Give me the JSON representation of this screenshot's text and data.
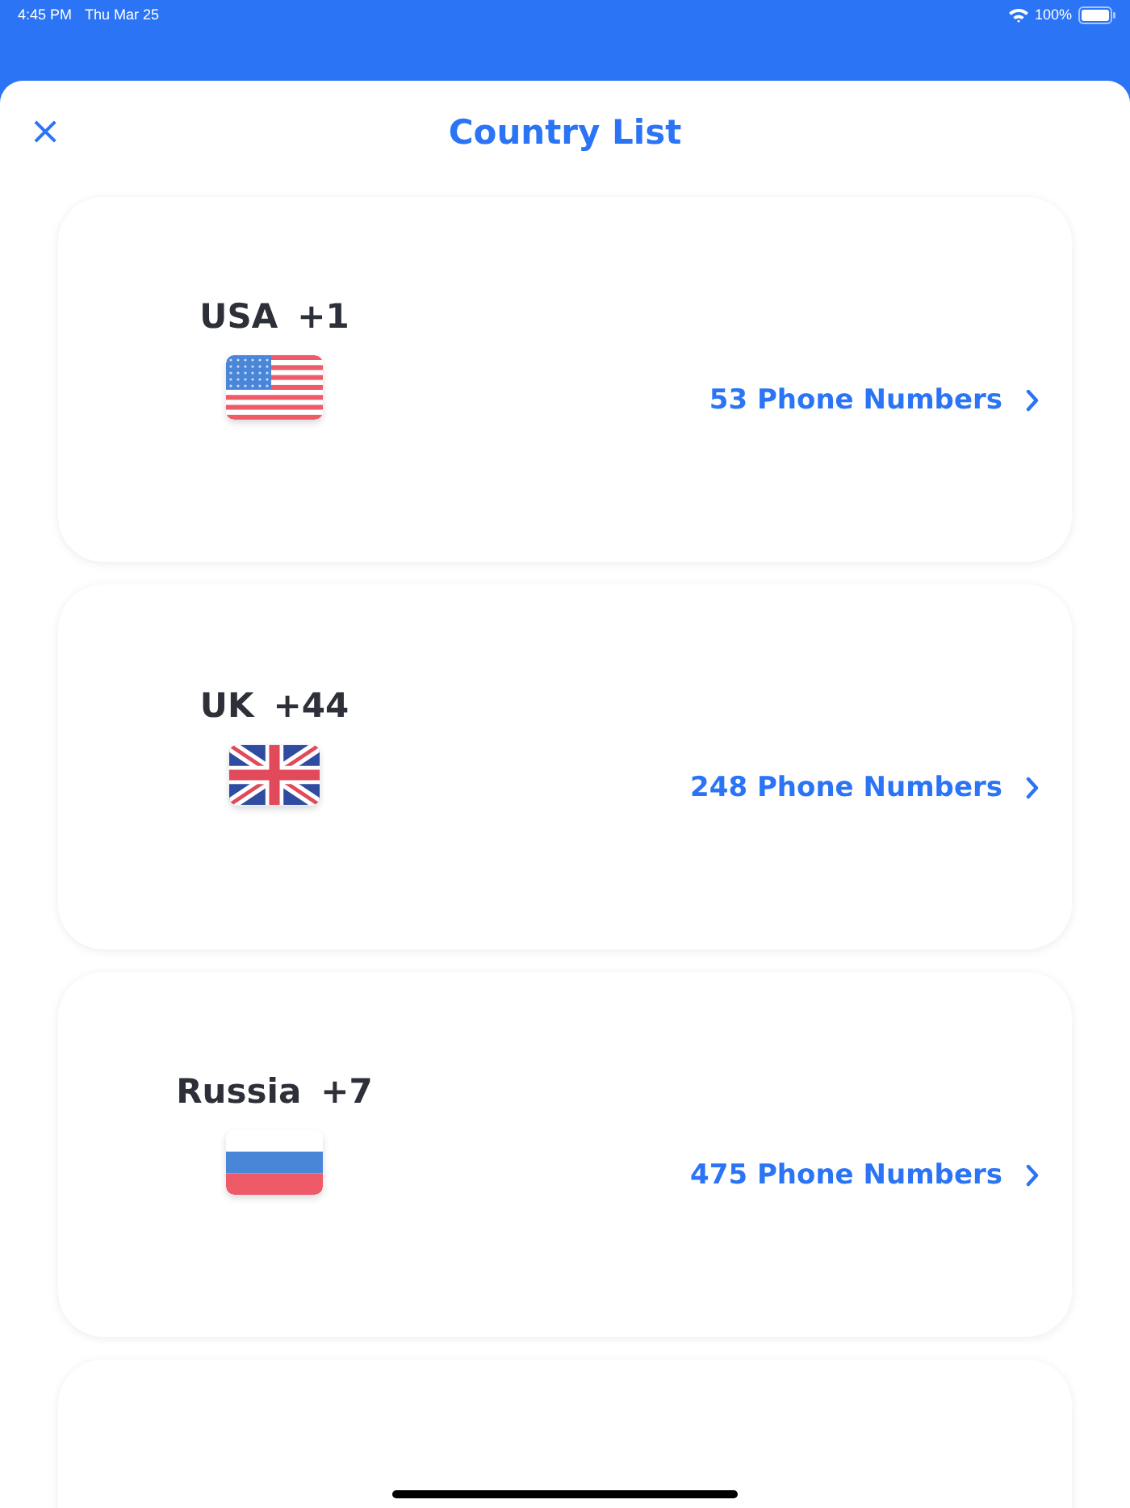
{
  "status_bar": {
    "time": "4:45 PM",
    "date": "Thu Mar 25",
    "battery": "100%"
  },
  "header": {
    "close": "×",
    "title": "Country List"
  },
  "countries": [
    {
      "name": "USA",
      "code": "+1",
      "kind": "usa",
      "numbers": "53 Phone Numbers"
    },
    {
      "name": "UK",
      "code": "+44",
      "kind": "uk",
      "numbers": "248 Phone Numbers"
    },
    {
      "name": "Russia",
      "code": "+7",
      "kind": "russia",
      "numbers": "475 Phone Numbers"
    },
    {
      "kind": "partial"
    }
  ]
}
